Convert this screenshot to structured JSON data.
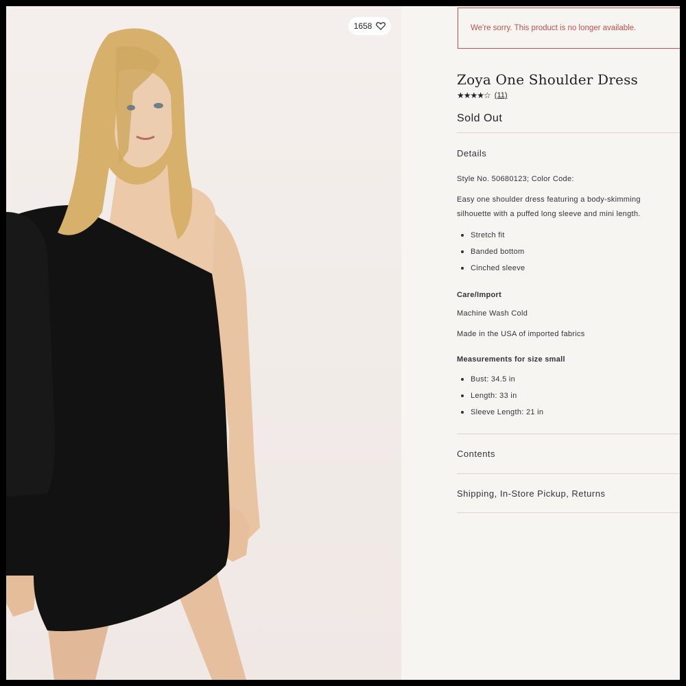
{
  "product": {
    "favorites_count": "1658",
    "alert": "We're sorry. This product is no longer available.",
    "title": "Zoya One Shoulder Dress",
    "stars": "★★★★☆",
    "review_count": "(11)",
    "status": "Sold Out"
  },
  "details": {
    "heading": "Details",
    "style": "Style No. 50680123; Color Code:",
    "description_line1": "Easy one shoulder dress featuring a body-skimming",
    "description_line2": "silhouette with a puffed long sleeve and mini length.",
    "features": [
      "Stretch fit",
      "Banded bottom",
      "Cinched sleeve"
    ],
    "care_heading": "Care/Import",
    "care": "Machine Wash Cold",
    "origin": "Made in the USA of imported fabrics",
    "measurements_heading": "Measurements for size small",
    "measurements": [
      "Bust: 34.5 in",
      "Length: 33 in",
      "Sleeve Length: 21 in"
    ]
  },
  "sections": {
    "contents": "Contents",
    "shipping": "Shipping, In-Store Pickup, Returns"
  },
  "colors": {
    "alert": "#c0504a",
    "dress": "#111111",
    "skin": "#e9c6a6",
    "hair": "#d9b36e"
  }
}
